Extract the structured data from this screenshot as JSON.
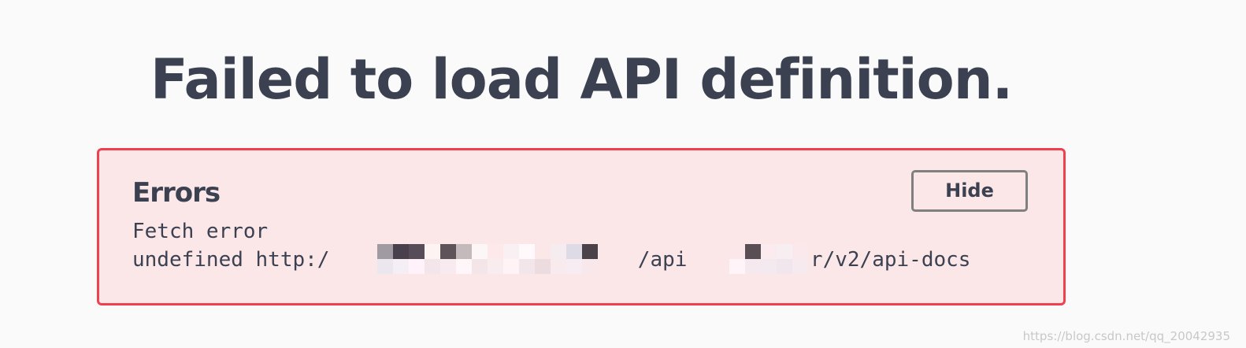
{
  "page": {
    "title": "Failed to load API definition."
  },
  "errors": {
    "heading": "Errors",
    "hide_label": "Hide",
    "line1": "Fetch error",
    "line2": "undefined http:/                         /api          r/v2/api-docs"
  },
  "watermark": "https://blog.csdn.net/qq_20042935",
  "colors": {
    "background": "#fafafa",
    "error_bg": "#fbe7e7",
    "error_border": "#f04050",
    "text": "#3b4151"
  }
}
